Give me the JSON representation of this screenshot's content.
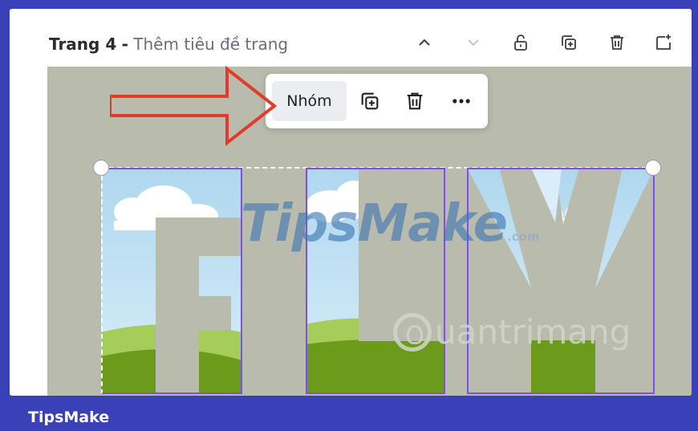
{
  "page_header": {
    "page_number_label": "Trang 4",
    "separator": "-",
    "title_placeholder": "Thêm tiêu đề trang"
  },
  "header_icons": [
    "chevron-up",
    "chevron-down",
    "lock",
    "duplicate",
    "delete",
    "add-page"
  ],
  "toolbar": {
    "group_label": "Nhóm",
    "icons": [
      "duplicate",
      "delete",
      "more"
    ]
  },
  "canvas": {
    "letters": [
      "F",
      "L",
      "Y"
    ],
    "background_color": "#b9bcad",
    "selection_color": "#7c4dff"
  },
  "arrow_color": "#e23b2a",
  "watermarks": {
    "tipsmake_text": "TipsMake",
    "tipsmake_domain": ".com",
    "quantrimang_text": "uantrimang"
  },
  "footer": {
    "brand": "TipsMake"
  }
}
